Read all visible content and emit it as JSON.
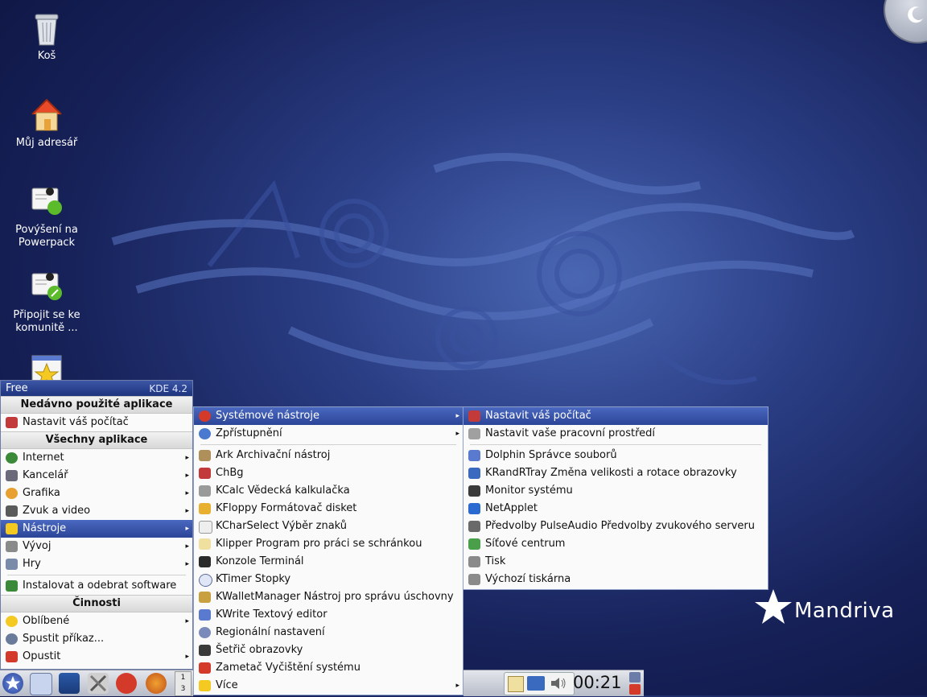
{
  "desktop": {
    "icons": [
      {
        "label": "Koš"
      },
      {
        "label": "Můj adresář"
      },
      {
        "label": "Povýšení na Powerpack"
      },
      {
        "label": "Připojit se ke komunitě ..."
      }
    ],
    "brand": "Mandriva"
  },
  "launcher": {
    "title": "Free",
    "version": "KDE 4.2",
    "sections": {
      "recent": "Nedávno použité aplikace",
      "all": "Všechny aplikace",
      "actions": "Činnosti"
    },
    "recent_items": [
      "Nastavit váš počítač"
    ],
    "categories": [
      "Internet",
      "Kancelář",
      "Grafika",
      "Zvuk a video",
      "Nástroje",
      "Vývoj",
      "Hry"
    ],
    "install_item": "Instalovat a odebrat software",
    "action_items": [
      "Oblíbené",
      "Spustit příkaz...",
      "Opustit"
    ]
  },
  "submenu_tools": {
    "items": [
      "Systémové nástroje",
      "Zpřístupnění",
      "Ark Archivační nástroj",
      "ChBg",
      "KCalc Vědecká kalkulačka",
      "KFloppy Formátovač disket",
      "KCharSelect Výběr znaků",
      "Klipper Program pro práci se schránkou",
      "Konzole Terminál",
      "KTimer Stopky",
      "KWalletManager Nástroj pro správu úschovny",
      "KWrite Textový editor",
      "Regionální nastavení",
      "Šetřič obrazovky",
      "Zametač Vyčištění systému",
      "Více"
    ]
  },
  "submenu_system": {
    "items": [
      "Nastavit váš počítač",
      "Nastavit vaše pracovní prostředí",
      "Dolphin Správce souborů",
      "KRandRTray Změna velikosti a rotace obrazovky",
      "Monitor systému",
      "NetApplet",
      "Předvolby PulseAudio Předvolby zvukového serveru",
      "Síťové centrum",
      "Tisk",
      "Výchozí tiskárna"
    ]
  },
  "taskbar": {
    "pager": [
      "1",
      "3"
    ],
    "clock": "00:21"
  },
  "colors": {
    "accent": "#2b4597",
    "wallpaper": "#17225a"
  }
}
